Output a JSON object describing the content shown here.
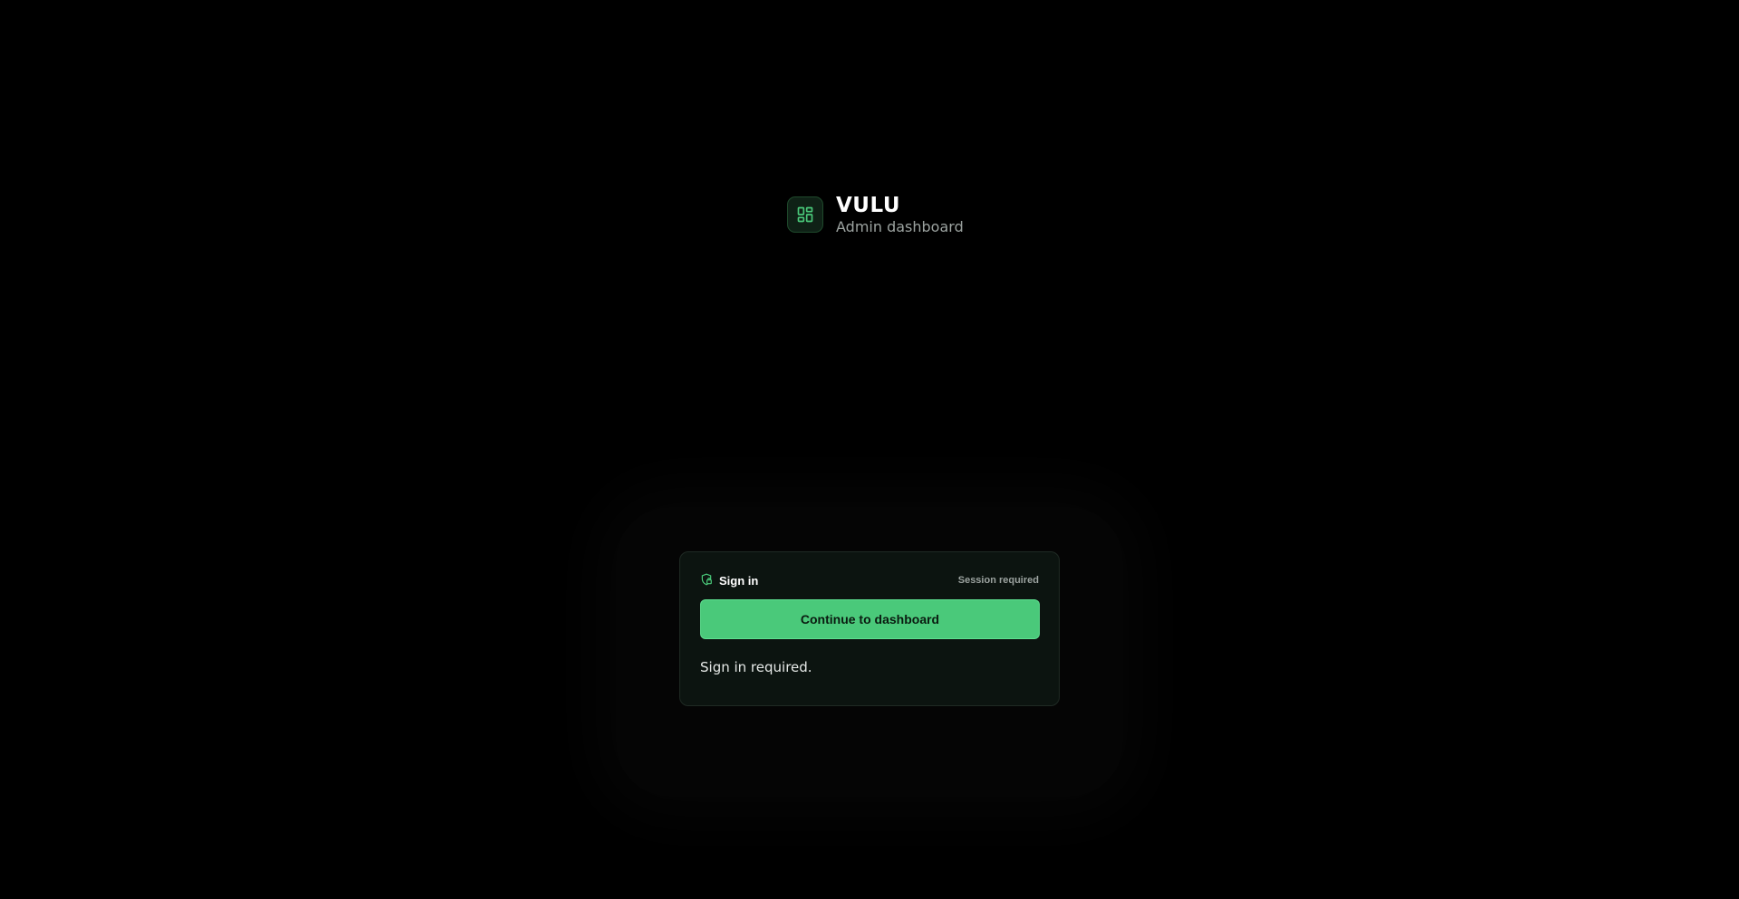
{
  "brand": {
    "name": "VULU",
    "subtitle": "Admin dashboard",
    "logo_icon": "dashboard-grid-icon"
  },
  "signin_card": {
    "title": "Sign in",
    "title_icon": "shield-lock-icon",
    "badge": "Session required",
    "button_label": "Continue to dashboard",
    "message": "Sign in required."
  },
  "colors": {
    "background": "#000000",
    "accent": "#4ac97a",
    "card_background": "#0c1410",
    "muted_text": "#9ca3a0"
  }
}
